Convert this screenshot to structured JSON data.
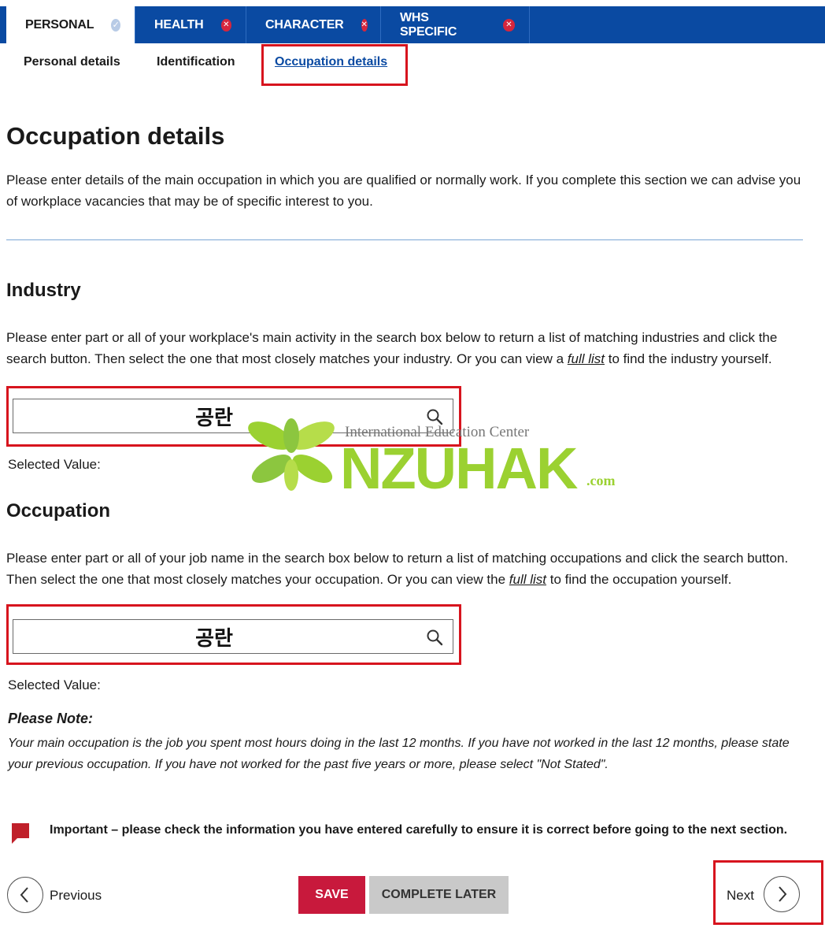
{
  "tabs": [
    {
      "label": "PERSONAL",
      "status": "complete"
    },
    {
      "label": "HEALTH",
      "status": "incomplete"
    },
    {
      "label": "CHARACTER",
      "status": "incomplete"
    },
    {
      "label": "WHS SPECIFIC",
      "status": "incomplete"
    }
  ],
  "subnav": {
    "personal_details": "Personal details",
    "identification": "Identification",
    "occupation_details": "Occupation details"
  },
  "page": {
    "title": "Occupation details",
    "intro": "Please enter details of the main occupation in which you are qualified or normally work. If you complete this section we can advise you of workplace vacancies that may be of specific interest to you."
  },
  "industry": {
    "heading": "Industry",
    "desc_before": "Please enter part or all of your workplace's main activity in the search box below to return a list of matching industries and click the search button. Then select the one that most closely matches your industry. Or you can view a ",
    "link": "full list",
    "desc_after": " to find the industry yourself.",
    "search_value": "공란",
    "selected_label": "Selected Value:"
  },
  "occupation": {
    "heading": "Occupation",
    "desc_before": "Please enter part or all of your job name in the search box below to return a list of matching occupations and click the search button. Then select the one that most closely matches your occupation. Or you can view the ",
    "link": "full list",
    "desc_after": " to find the occupation yourself.",
    "search_value": "공란",
    "selected_label": "Selected Value:"
  },
  "note": {
    "title": "Please Note:",
    "body": "Your main occupation is the job you spent most hours doing in the last 12 months. If you have not worked in the last 12 months, please state your previous occupation. If you have not worked for the past five years or more, please select \"Not Stated\"."
  },
  "important": "Important – please check the information you have entered carefully to ensure it is correct before going to the next section.",
  "buttons": {
    "previous": "Previous",
    "save": "SAVE",
    "complete_later": "COMPLETE LATER",
    "next": "Next"
  },
  "watermark": {
    "subtitle": "International Education Center",
    "brand": "NZUHAK",
    "suffix": ".com"
  },
  "colors": {
    "tab_blue": "#0a4aa2",
    "save_red": "#c8193c",
    "highlight_red": "#d7141e",
    "watermark_green": "#9bd131"
  }
}
